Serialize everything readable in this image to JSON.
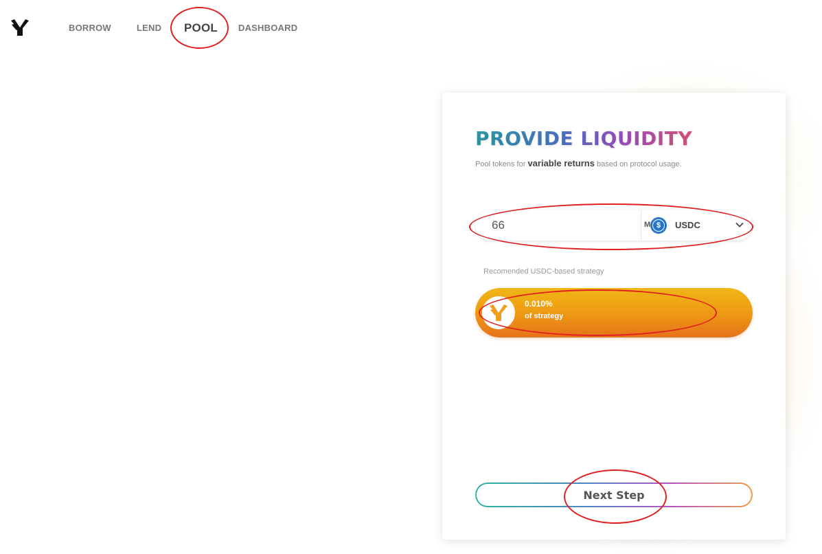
{
  "nav": {
    "items": [
      {
        "label": "BORROW"
      },
      {
        "label": "LEND"
      },
      {
        "label": "POOL"
      },
      {
        "label": "DASHBOARD"
      }
    ]
  },
  "card": {
    "title": "PROVIDE LIQUIDITY",
    "subtitle_pre": "Pool tokens for ",
    "subtitle_em": "variable returns",
    "subtitle_post": " based on protocol usage.",
    "amount_value": "66",
    "max_label": "Max",
    "token": {
      "symbol": "USDC",
      "icon": "usdc-icon"
    },
    "strategy_caption": "Recomended USDC-based strategy",
    "strategy_value": "0.010%",
    "strategy_label": "of strategy",
    "next_label": "Next Step"
  },
  "colors": {
    "strategy_gradient": [
      "#f0b617",
      "#e5731b"
    ],
    "title_gradient": [
      "#2a9fa8",
      "#4f74c9",
      "#a44fc0",
      "#e0557a"
    ],
    "annotation": "#e02020",
    "usdc": "#2775ca"
  }
}
